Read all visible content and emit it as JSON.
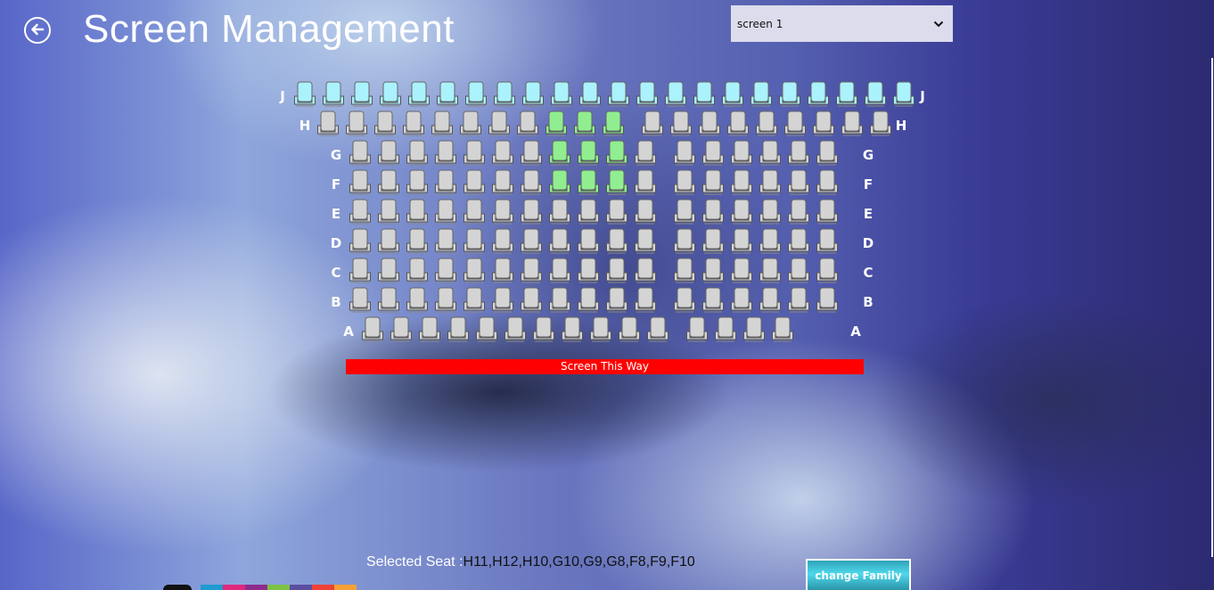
{
  "header": {
    "back_icon": "back-arrow-circle-icon",
    "title": "Screen Management"
  },
  "screen_select": {
    "selected": "screen 1",
    "icon": "chevron-down-icon"
  },
  "colors": {
    "available": "#d4d4d4",
    "selected": "#90ee90",
    "family": "#aaf2fc",
    "screen_bar": "#ff0000"
  },
  "rows": [
    {
      "label": "J",
      "sections": [
        {
          "seats": 22
        }
      ],
      "status": "family",
      "selected": []
    },
    {
      "label": "H",
      "sections": [
        {
          "seats": 11
        },
        {
          "seats": 9
        }
      ],
      "status": "available",
      "selected": [
        8,
        9,
        10
      ]
    },
    {
      "label": "G",
      "sections": [
        {
          "seats": 11
        },
        {
          "seats": 6
        }
      ],
      "status": "available",
      "selected": [
        7,
        8,
        9
      ]
    },
    {
      "label": "F",
      "sections": [
        {
          "seats": 11
        },
        {
          "seats": 6
        }
      ],
      "status": "available",
      "selected": [
        7,
        8,
        9
      ]
    },
    {
      "label": "E",
      "sections": [
        {
          "seats": 11
        },
        {
          "seats": 6
        }
      ],
      "status": "available",
      "selected": []
    },
    {
      "label": "D",
      "sections": [
        {
          "seats": 11
        },
        {
          "seats": 6
        }
      ],
      "status": "available",
      "selected": []
    },
    {
      "label": "C",
      "sections": [
        {
          "seats": 11
        },
        {
          "seats": 6
        }
      ],
      "status": "available",
      "selected": []
    },
    {
      "label": "B",
      "sections": [
        {
          "seats": 11
        },
        {
          "seats": 6
        }
      ],
      "status": "available",
      "selected": []
    },
    {
      "label": "A",
      "sections": [
        {
          "seats": 11
        },
        {
          "seats": 4
        }
      ],
      "status": "available",
      "selected": []
    }
  ],
  "screen_bar": {
    "label": "Screen This Way"
  },
  "footer": {
    "selected_label": "Selected Seat :",
    "selected_value": "H11,H12,H10,G10,G9,G8,F8,F9,F10",
    "change_button": "change Family"
  },
  "logo_swatches": [
    "#1e9bd0",
    "#e0287c",
    "#8e2c8e",
    "#7cc243",
    "#5b4ea0",
    "#ef4136",
    "#f7a034"
  ]
}
